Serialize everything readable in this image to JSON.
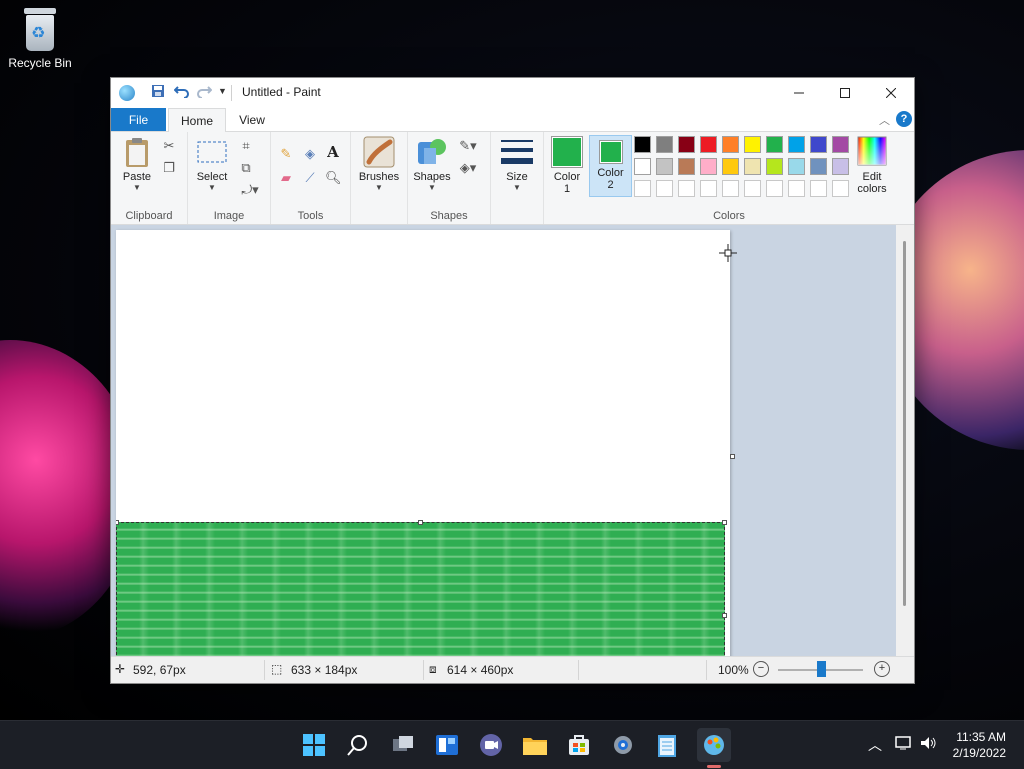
{
  "desktop": {
    "recycle_bin_label": "Recycle Bin"
  },
  "window": {
    "title": "Untitled - Paint",
    "tabs": {
      "file": "File",
      "home": "Home",
      "view": "View"
    },
    "help": "?"
  },
  "ribbon": {
    "clipboard": {
      "label": "Clipboard",
      "paste": "Paste"
    },
    "image": {
      "label": "Image",
      "select": "Select"
    },
    "tools": {
      "label": "Tools"
    },
    "brushes": "Brushes",
    "shapes": {
      "label": "Shapes",
      "shapes_btn": "Shapes"
    },
    "size": "Size",
    "colors": {
      "label": "Colors",
      "color1_line1": "Color",
      "color1_line2": "1",
      "color2_line1": "Color",
      "color2_line2": "2",
      "edit_line1": "Edit",
      "edit_line2": "colors",
      "color1_value": "#22b14c",
      "color2_value": "#22b14c",
      "palette_row1": [
        "#000000",
        "#7f7f7f",
        "#880015",
        "#ed1c24",
        "#ff7f27",
        "#fff200",
        "#22b14c",
        "#00a2e8",
        "#3f48cc",
        "#a349a4"
      ],
      "palette_row2": [
        "#ffffff",
        "#c3c3c3",
        "#b97a57",
        "#ffaec9",
        "#ffc90e",
        "#efe4b0",
        "#b5e61d",
        "#99d9ea",
        "#7092be",
        "#c8bfe7"
      ]
    }
  },
  "status": {
    "cursor_pos": "592, 67px",
    "selection_size": "633 × 184px",
    "canvas_size": "614 × 460px",
    "zoom": "100%"
  },
  "taskbar": {
    "time": "11:35 AM",
    "date": "2/19/2022"
  }
}
